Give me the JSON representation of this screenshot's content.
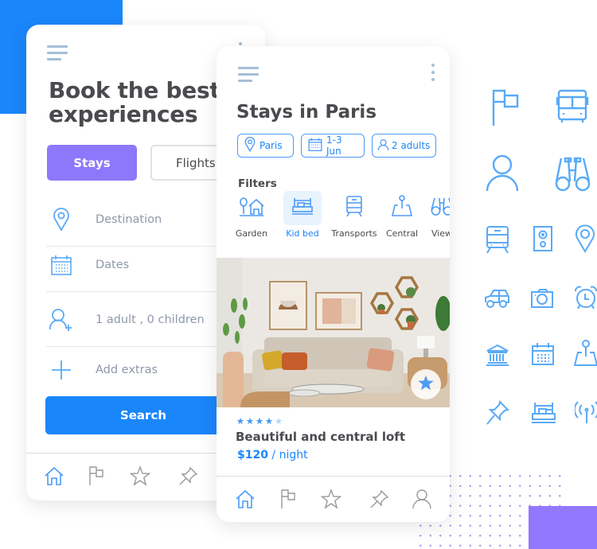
{
  "colors": {
    "primary": "#1a86fb",
    "accent": "#8d78fb",
    "icon": "#5aaaf7",
    "text": "#4a4a4f",
    "muted": "#8f97aa"
  },
  "card1": {
    "title_line1": "Book the best",
    "title_line2": "experiences",
    "tabs": {
      "stays": "Stays",
      "flights": "Flights"
    },
    "fields": [
      {
        "icon": "location-pin-icon",
        "label": "Destination"
      },
      {
        "icon": "calendar-icon",
        "label": "Dates"
      },
      {
        "icon": "add-person-icon",
        "label": "1 adult , 0 children"
      },
      {
        "icon": "plus-icon",
        "label": "Add extras"
      }
    ],
    "search_label": "Search",
    "nav": [
      "home-icon",
      "flag-icon",
      "star-icon",
      "pin-icon"
    ]
  },
  "card2": {
    "title": "Stays in Paris",
    "chips": [
      {
        "icon": "location-pin-icon",
        "label": "Paris"
      },
      {
        "icon": "calendar-icon",
        "label": "1-3 Jun"
      },
      {
        "icon": "person-icon",
        "label": "2 adults"
      }
    ],
    "filters_title": "Filters",
    "filters": [
      {
        "icon": "garden-icon",
        "label": "Garden",
        "selected": false
      },
      {
        "icon": "bed-icon",
        "label": "Kid bed",
        "selected": true
      },
      {
        "icon": "train-icon",
        "label": "Transports",
        "selected": false
      },
      {
        "icon": "map-pin-icon",
        "label": "Central",
        "selected": false
      },
      {
        "icon": "binoculars-icon",
        "label": "View",
        "selected": false
      }
    ],
    "listing": {
      "rating": 4,
      "rating_max": 5,
      "title": "Beautiful and central loft",
      "price": "$120",
      "price_unit": " / night"
    },
    "nav": [
      "home-icon",
      "flag-icon",
      "star-icon",
      "pin-icon",
      "user-icon"
    ]
  },
  "icon_grid": [
    "flag-icon",
    "bus-icon",
    "person-icon",
    "binoculars-icon",
    "train-icon",
    "speaker-icon",
    "location-pin-icon",
    "car-icon",
    "camera-icon",
    "alarm-clock-icon",
    "museum-icon",
    "calendar-icon",
    "map-pin-icon",
    "pushpin-icon",
    "bed-icon",
    "antenna-icon"
  ]
}
